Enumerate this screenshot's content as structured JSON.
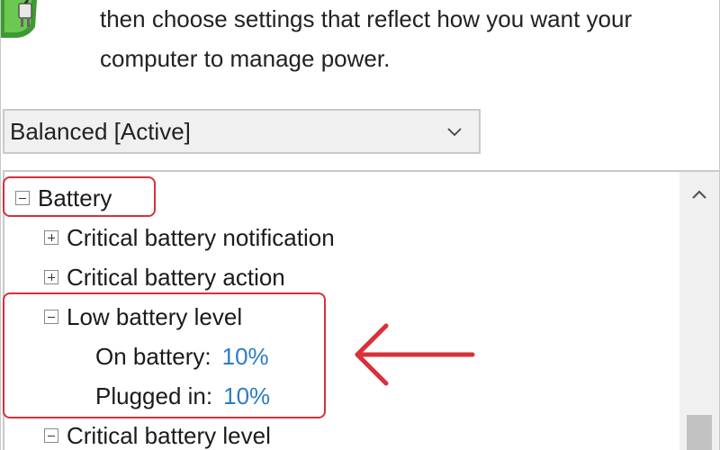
{
  "description": {
    "lines": [
      "then choose settings that reflect how you want your",
      "computer to manage power."
    ]
  },
  "plan_select": {
    "value": "Balanced [Active]"
  },
  "tree": {
    "battery": {
      "label": "Battery"
    },
    "critical_notification": {
      "label": "Critical battery notification"
    },
    "critical_action": {
      "label": "Critical battery action"
    },
    "low_level": {
      "label": "Low battery level",
      "on_battery": {
        "label": "On battery:",
        "value": "10%"
      },
      "plugged_in": {
        "label": "Plugged in:",
        "value": "10%"
      }
    },
    "critical_level": {
      "label": "Critical battery level"
    }
  },
  "colors": {
    "accent_value": "#2a7cc7",
    "highlight": "#d9303a",
    "battery_icon_green": "#4cae3c"
  },
  "icons": {
    "battery": "battery-plug-icon",
    "dropdown": "chevron-down-icon",
    "scroll_up": "chevron-up-icon",
    "annotation": "left-arrow-icon"
  }
}
